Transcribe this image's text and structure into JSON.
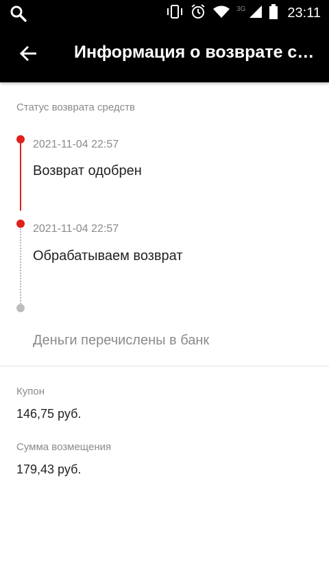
{
  "status_bar": {
    "network_label": "3G",
    "time": "23:11"
  },
  "app_bar": {
    "title": "Информация о возврате средств"
  },
  "refund_status": {
    "section_label": "Статус возврата средств",
    "steps": [
      {
        "timestamp": "2021-11-04 22:57",
        "title": "Возврат одобрен",
        "state": "done"
      },
      {
        "timestamp": "2021-11-04 22:57",
        "title": "Обрабатываем возврат",
        "state": "done"
      },
      {
        "timestamp": "",
        "title": "Деньги перечислены в банк",
        "state": "pending"
      }
    ]
  },
  "details": {
    "coupon_label": "Купон",
    "coupon_value": "146,75 руб.",
    "refund_amount_label": "Сумма возмещения",
    "refund_amount_value": "179,43 руб."
  },
  "colors": {
    "accent_red": "#e0201b",
    "pending_grey": "#bdbdbd"
  }
}
